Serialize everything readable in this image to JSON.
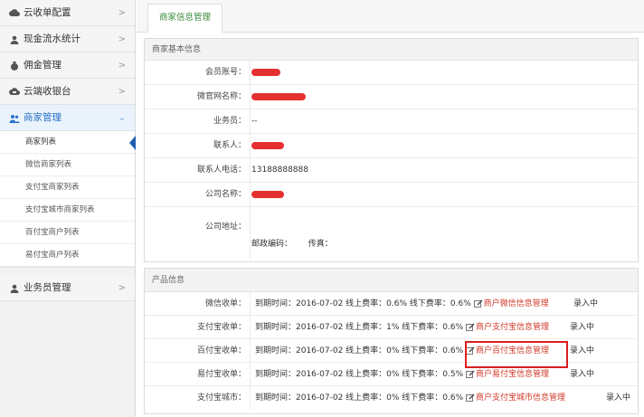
{
  "sidebar": {
    "items": [
      {
        "label": "云收单配置",
        "icon": "cloud-icon"
      },
      {
        "label": "现金流水统计",
        "icon": "person-icon"
      },
      {
        "label": "佣金管理",
        "icon": "money-bag-icon"
      },
      {
        "label": "云端收银台",
        "icon": "cloud-cashier-icon"
      },
      {
        "label": "商家管理",
        "icon": "users-icon"
      }
    ],
    "sub_items": [
      "商家列表",
      "微信商家列表",
      "支付宝商家列表",
      "支付宝城市商家列表",
      "百付宝商户列表",
      "易付宝商户列表"
    ],
    "last_item": {
      "label": "业务员管理",
      "icon": "person-icon"
    }
  },
  "tab": {
    "label": "商家信息管理"
  },
  "basic": {
    "header": "商家基本信息",
    "member_label": "会员账号：",
    "site_label": "微官网名称：",
    "sales_label": "业务员：",
    "sales_value": "--",
    "contact_label": "联系人：",
    "phone_label": "联系人电话：",
    "phone_value": "13188888888",
    "company_label": "公司名称：",
    "address_label": "公司地址：",
    "postcode_label": "邮政编码：",
    "fax_label": "传真："
  },
  "products": {
    "header": "产品信息",
    "rows": [
      {
        "label": "微信收单：",
        "detail": "到期时间：2016-07-02  线上费率：0.6%  线下费率：0.6%",
        "link": "商户微信信息管理",
        "status": "录入中"
      },
      {
        "label": "支付宝收单：",
        "detail": "到期时间：2016-07-02  线上费率：1%  线下费率：0.6%",
        "link": "商户支付宝信息管理",
        "status": "录入中"
      },
      {
        "label": "百付宝收单：",
        "detail": "到期时间：2016-07-02  线上费率：0%  线下费率：0.6%",
        "link": "商户百付宝信息管理",
        "status": "录入中"
      },
      {
        "label": "易付宝收单：",
        "detail": "到期时间：2016-07-02  线上费率：0%  线下费率：0.5%",
        "link": "商户易付宝信息管理",
        "status": "录入中"
      },
      {
        "label": "支付宝城市：",
        "detail": "到期时间：2016-07-02  线上费率：0%  线下费率：0.6%",
        "link": "商户支付宝城市信息管理",
        "status": "录入中"
      }
    ]
  },
  "colors": {
    "accent": "#2a72c8",
    "link": "#d23a2a",
    "highlight": "#d91f1f",
    "redaction": "#e53030"
  }
}
